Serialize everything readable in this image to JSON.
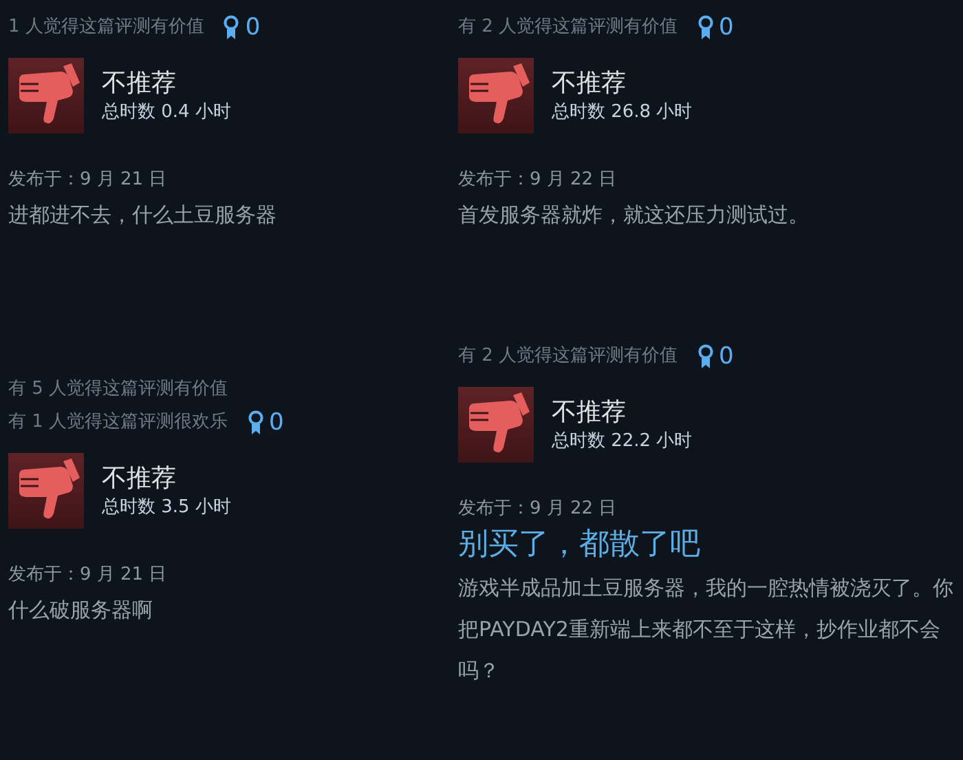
{
  "columns": [
    {
      "reviews": [
        {
          "helpful": [
            "1 人觉得这篇评测有价值"
          ],
          "award_count": "0",
          "verdict": {
            "kind": "not_recommended",
            "label": "不推荐"
          },
          "hours": "总时数 0.4 小时",
          "posted": "发布于：9 月 21 日",
          "body": "进都进不去，什么土豆服务器"
        },
        {
          "helpful": [
            "有 5 人觉得这篇评测有价值",
            "有 1 人觉得这篇评测很欢乐"
          ],
          "award_count": "0",
          "verdict": {
            "kind": "not_recommended",
            "label": "不推荐"
          },
          "hours": "总时数 3.5 小时",
          "posted": "发布于：9 月 21 日",
          "body": "什么破服务器啊"
        }
      ]
    },
    {
      "reviews": [
        {
          "helpful": [
            "有 2 人觉得这篇评测有价值"
          ],
          "award_count": "0",
          "verdict": {
            "kind": "not_recommended",
            "label": "不推荐"
          },
          "hours": "总时数 26.8 小时",
          "posted": "发布于：9 月 22 日",
          "body": "首发服务器就炸，就这还压力测试过。"
        },
        {
          "helpful": [
            "有 2 人觉得这篇评测有价值"
          ],
          "award_count": "0",
          "verdict": {
            "kind": "not_recommended",
            "label": "不推荐"
          },
          "hours": "总时数 22.2 小时",
          "posted": "发布于：9 月 22 日",
          "title": "别买了，都散了吧",
          "body": "游戏半成品加土豆服务器，我的一腔热情被浇灭了。你把PAYDAY2重新端上来都不至于这样，抄作业都不会吗？"
        }
      ]
    }
  ]
}
